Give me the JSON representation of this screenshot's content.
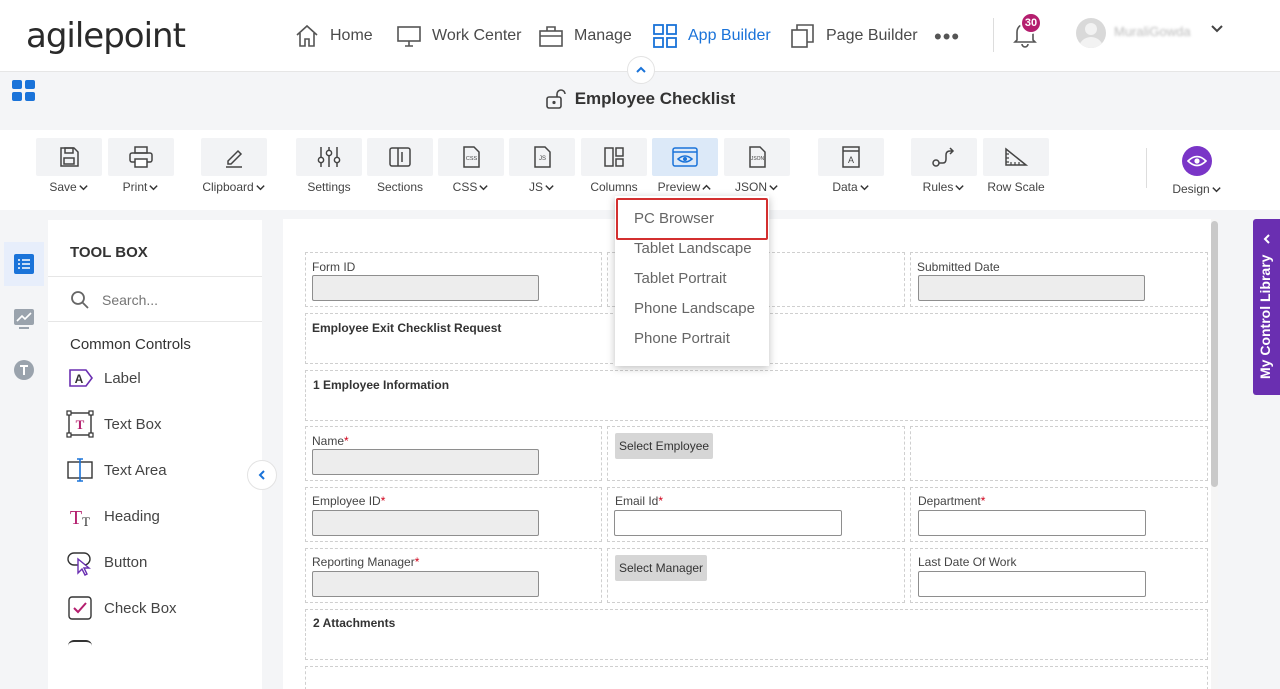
{
  "app": {
    "logo_text": "agilepoint",
    "page_title": "Employee Checklist"
  },
  "nav": {
    "home": "Home",
    "work_center": "Work Center",
    "manage": "Manage",
    "app_builder": "App Builder",
    "page_builder": "Page Builder",
    "more": "•••",
    "notification_count": "30",
    "username": "MuraliGowda"
  },
  "toolbar": {
    "save": "Save",
    "print": "Print",
    "clipboard": "Clipboard",
    "settings": "Settings",
    "sections": "Sections",
    "css": "CSS",
    "js": "JS",
    "columns": "Columns",
    "preview": "Preview",
    "json": "JSON",
    "data": "Data",
    "rules": "Rules",
    "row_scale": "Row Scale",
    "design": "Design"
  },
  "preview_menu": {
    "items": [
      "PC Browser",
      "Tablet Landscape",
      "Tablet Portrait",
      "Phone Landscape",
      "Phone Portrait"
    ],
    "highlighted": "PC Browser"
  },
  "toolbox": {
    "title": "TOOL BOX",
    "search_placeholder": "Search...",
    "section": "Common Controls",
    "items": [
      "Label",
      "Text Box",
      "Text Area",
      "Heading",
      "Button",
      "Check Box"
    ]
  },
  "form": {
    "form_id": "Form ID",
    "submitted_date": "Submitted Date",
    "header": "Employee Exit Checklist Request",
    "section1": "1 Employee Information",
    "name": "Name",
    "select_employee": "Select Employee",
    "employee_id": "Employee ID",
    "email_id": "Email Id",
    "department": "Department",
    "reporting_manager": "Reporting Manager",
    "select_manager": "Select Manager",
    "last_date_of_work": "Last Date Of Work",
    "section2": "2 Attachments",
    "required_mark": "*"
  },
  "right_panel": {
    "label": "My Control Library"
  },
  "colors": {
    "accent_blue": "#1a73d9",
    "purple": "#6a2fb1",
    "badge": "#b41e6e",
    "highlight_red": "#d32f2f"
  }
}
